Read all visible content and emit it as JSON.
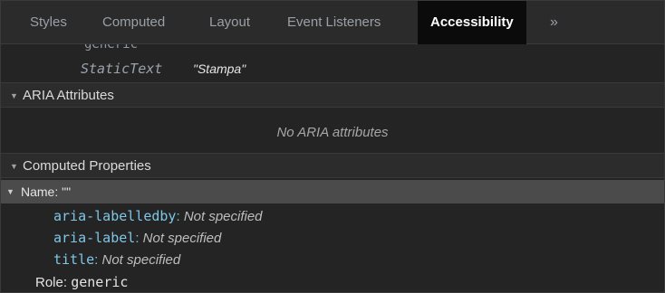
{
  "tabs": [
    "Styles",
    "Computed",
    "Layout",
    "Event Listeners",
    "Accessibility"
  ],
  "active_tab": "Accessibility",
  "more_tabs_glyph": "»",
  "tree": {
    "partial_node_text": "generic",
    "static_text_keyword": "StaticText",
    "static_text_value": "\"Stampa\""
  },
  "aria_section": {
    "title": "ARIA Attributes",
    "empty_message": "No ARIA attributes"
  },
  "computed_section": {
    "title": "Computed Properties",
    "name_label": "Name: \"\"",
    "name_sources": [
      {
        "key": "aria-labelledby",
        "sep": ":",
        "value": "Not specified"
      },
      {
        "key": "aria-label",
        "sep": ":",
        "value": "Not specified"
      },
      {
        "key": "title",
        "sep": ":",
        "value": "Not specified"
      }
    ],
    "role_label": "Role:",
    "role_value": "generic"
  },
  "colors": {
    "panel_bg": "#242424",
    "active_tab_bg": "#0b0b0b",
    "selected_row_bg": "#4b4b4b",
    "attr_key": "#7ec6e6"
  },
  "icons": {
    "expand": "triangle-down-icon",
    "overflow": "chevron-double-right-icon"
  }
}
